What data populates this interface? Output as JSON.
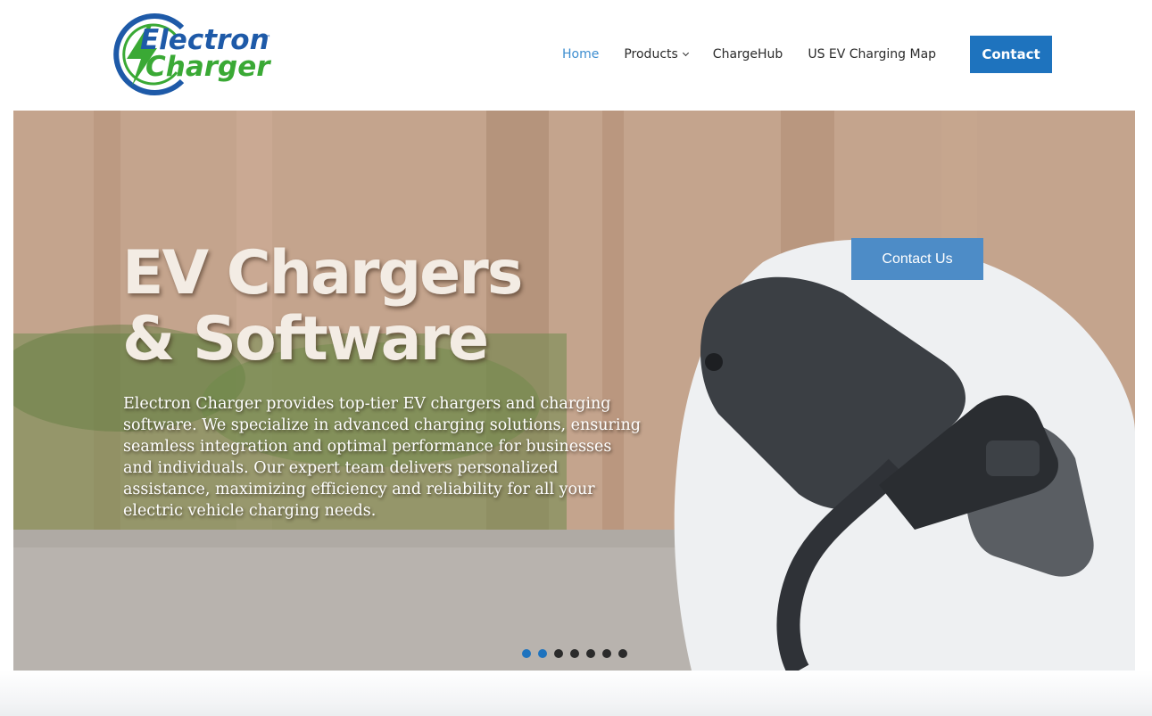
{
  "brand": {
    "logo_line1": "Electron",
    "logo_line2": "Charger",
    "logo_mark": "™",
    "logo_colors": {
      "blue": "#1e5aa8",
      "green": "#3aa935"
    }
  },
  "nav": {
    "items": [
      {
        "label": "Home",
        "active": true
      },
      {
        "label": "Products",
        "has_dropdown": true
      },
      {
        "label": "ChargeHub"
      },
      {
        "label": "US EV Charging Map"
      }
    ],
    "contact_label": "Contact",
    "accent": "#1e73be",
    "active_color": "#3e8ed0"
  },
  "hero": {
    "title_line1": "EV Chargers",
    "title_line2": "& Software",
    "description": "Electron Charger provides top-tier EV chargers and charging software. We specialize in advanced charging solutions, ensuring seamless integration and optimal performance for businesses and individuals. Our expert team delivers personalized assistance, maximizing efficiency and reliability for all your electric vehicle charging needs.",
    "cta_label": "Contact Us",
    "slides_total": 7,
    "active_slides": [
      1,
      2
    ]
  },
  "icons": {
    "logo": "lightning-bolt-icon",
    "dropdown": "chevron-down-icon"
  }
}
